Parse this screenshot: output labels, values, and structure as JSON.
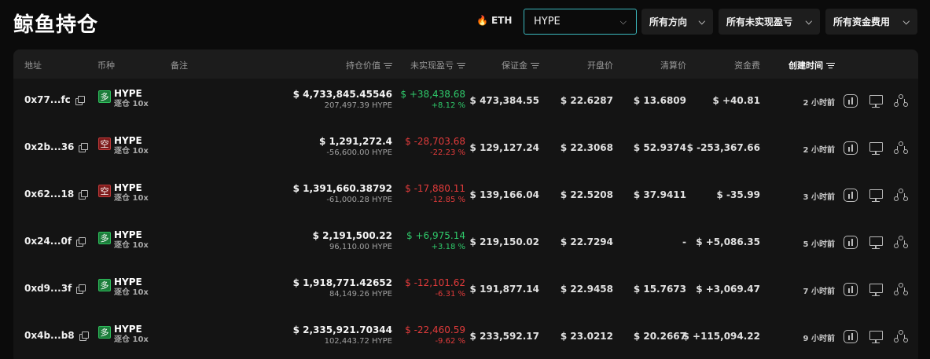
{
  "page_title": "鲸鱼持仓",
  "hot_coin": {
    "icon": "fire-icon",
    "label": "ETH"
  },
  "coin_select": {
    "value": "HYPE"
  },
  "filters": [
    {
      "label": "所有方向"
    },
    {
      "label": "所有未实现盈亏"
    },
    {
      "label": "所有资金费用"
    }
  ],
  "table": {
    "headers": {
      "address": "地址",
      "coin": "币种",
      "note": "备注",
      "position_value": "持仓价值",
      "unrealized_pnl": "未实现盈亏",
      "margin": "保证金",
      "entry_price": "开盘价",
      "liq_price": "清算价",
      "funding": "资金费",
      "created": "创建时间"
    },
    "rows": [
      {
        "address": "0x77...fc",
        "side": "多",
        "side_type": "long",
        "coin": "HYPE",
        "mode": "逐仓 10x",
        "value": "$ 4,733,845.45546",
        "size": "207,497.39 HYPE",
        "pnl": "$ +38,438.68",
        "pnl_pct": "+8.12 %",
        "pnl_sign": "pos",
        "margin": "$ 473,384.55",
        "entry": "$ 22.6287",
        "liq": "$ 13.6809",
        "funding": "$ +40.81",
        "funding_sign": "pos",
        "time": "2 小时前"
      },
      {
        "address": "0x2b...36",
        "side": "空",
        "side_type": "short",
        "coin": "HYPE",
        "mode": "逐仓 10x",
        "value": "$ 1,291,272.4",
        "size": "-56,600.00 HYPE",
        "pnl": "$ -28,703.68",
        "pnl_pct": "-22.23 %",
        "pnl_sign": "neg",
        "margin": "$ 129,127.24",
        "entry": "$ 22.3068",
        "liq": "$ 52.9374",
        "funding": "$ -253,367.66",
        "funding_sign": "neg",
        "time": "2 小时前"
      },
      {
        "address": "0x62...18",
        "side": "空",
        "side_type": "short",
        "coin": "HYPE",
        "mode": "逐仓 10x",
        "value": "$ 1,391,660.38792",
        "size": "-61,000.28 HYPE",
        "pnl": "$ -17,880.11",
        "pnl_pct": "-12.85 %",
        "pnl_sign": "neg",
        "margin": "$ 139,166.04",
        "entry": "$ 22.5208",
        "liq": "$ 37.9411",
        "funding": "$ -35.99",
        "funding_sign": "neg",
        "time": "3 小时前"
      },
      {
        "address": "0x24...0f",
        "side": "多",
        "side_type": "long",
        "coin": "HYPE",
        "mode": "逐仓 10x",
        "value": "$ 2,191,500.22",
        "size": "96,110.00 HYPE",
        "pnl": "$ +6,975.14",
        "pnl_pct": "+3.18 %",
        "pnl_sign": "pos",
        "margin": "$ 219,150.02",
        "entry": "$ 22.7294",
        "liq": "-",
        "funding": "$ +5,086.35",
        "funding_sign": "pos",
        "time": "5 小时前"
      },
      {
        "address": "0xd9...3f",
        "side": "多",
        "side_type": "long",
        "coin": "HYPE",
        "mode": "逐仓 10x",
        "value": "$ 1,918,771.42652",
        "size": "84,149.26 HYPE",
        "pnl": "$ -12,101.62",
        "pnl_pct": "-6.31 %",
        "pnl_sign": "neg",
        "margin": "$ 191,877.14",
        "entry": "$ 22.9458",
        "liq": "$ 15.7673",
        "funding": "$ +3,069.47",
        "funding_sign": "pos",
        "time": "7 小时前"
      },
      {
        "address": "0x4b...b8",
        "side": "多",
        "side_type": "long",
        "coin": "HYPE",
        "mode": "逐仓 10x",
        "value": "$ 2,335,921.70344",
        "size": "102,443.72 HYPE",
        "pnl": "$ -22,460.59",
        "pnl_pct": "-9.62 %",
        "pnl_sign": "neg",
        "margin": "$ 233,592.17",
        "entry": "$ 23.0212",
        "liq": "$ 20.2667",
        "funding": "$ +115,094.22",
        "funding_sign": "pos",
        "time": "9 小时前"
      }
    ],
    "row_actions": [
      "chart-icon",
      "monitor-icon",
      "share-icon"
    ]
  },
  "colors": {
    "positive": "#2fca6b",
    "negative": "#e23b3b",
    "accent": "#3bb8bd"
  }
}
